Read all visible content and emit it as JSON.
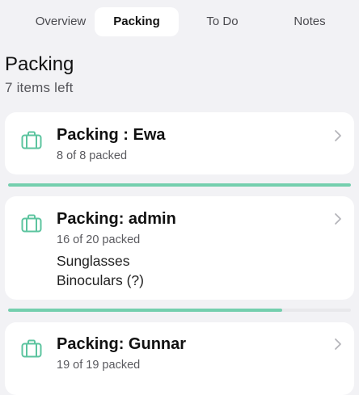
{
  "tabs": [
    {
      "label": "Overview",
      "active": false
    },
    {
      "label": "Packing",
      "active": true
    },
    {
      "label": "To Do",
      "active": false
    },
    {
      "label": "Notes",
      "active": false
    }
  ],
  "header": {
    "title": "Packing",
    "subtitle": "7 items left"
  },
  "colors": {
    "accent": "#74cfae",
    "icon": "#5cc49f"
  },
  "cards": [
    {
      "title": "Packing : Ewa",
      "status": "8 of 8 packed",
      "progress": 1.0,
      "missing": [],
      "icon": "suitcase-icon"
    },
    {
      "title": "Packing: admin",
      "status": "16 of 20 packed",
      "progress": 0.8,
      "missing": [
        "Sunglasses",
        "Binoculars (?)"
      ],
      "icon": "suitcase-icon"
    },
    {
      "title": "Packing: Gunnar",
      "status": "19 of 19 packed",
      "progress": 1.0,
      "missing": [],
      "icon": "suitcase-icon"
    }
  ]
}
